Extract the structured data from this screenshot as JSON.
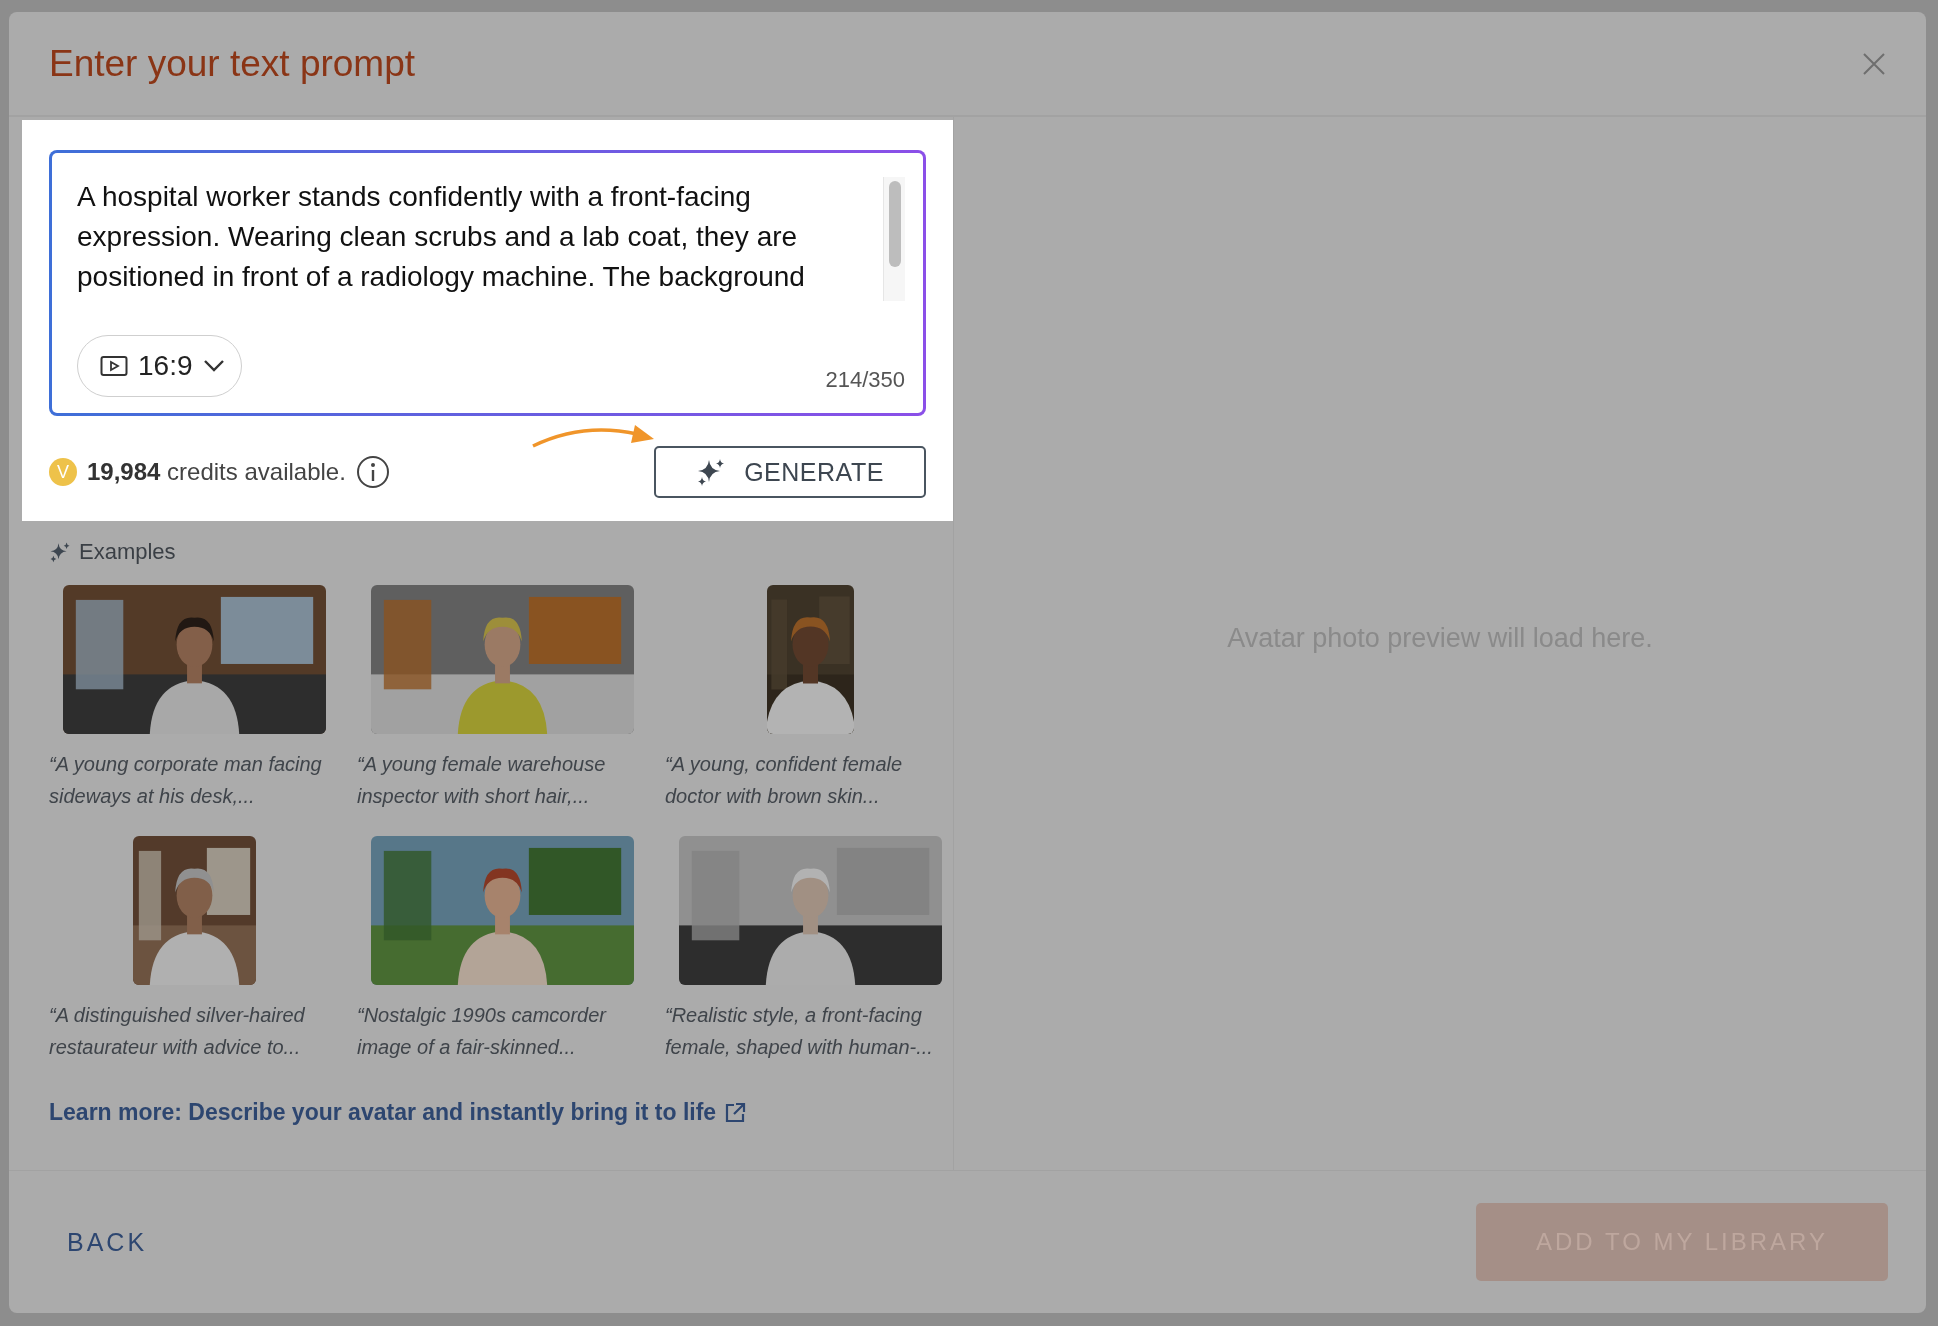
{
  "dialog": {
    "title": "Enter your text prompt"
  },
  "prompt": {
    "value": "A hospital worker stands confidently with a front-facing expression. Wearing clean scrubs and a lab coat, they are positioned in front of a radiology machine. The background",
    "aspect_ratio": "16:9",
    "char_count": "214/350"
  },
  "credits": {
    "coin": "V",
    "amount": "19,984",
    "label": "credits available."
  },
  "generate_button": "GENERATE",
  "examples": {
    "heading": "Examples",
    "items": [
      {
        "caption": "“A young corporate man facing sideways at his desk,..."
      },
      {
        "caption": "“A young female warehouse inspector with short hair,..."
      },
      {
        "caption": "“A young, confident female doctor with brown skin..."
      },
      {
        "caption": "“A distinguished silver-haired restaurateur with advice to..."
      },
      {
        "caption": "“Nostalgic 1990s camcorder image of a fair-skinned..."
      },
      {
        "caption": "“Realistic style, a front-facing female, shaped with human-..."
      }
    ]
  },
  "learn_more": "Learn more: Describe your avatar and instantly bring it to life",
  "preview": {
    "message": "Avatar photo preview will load here."
  },
  "footer": {
    "back_button": "BACK",
    "add_button": {
      "label": "ADD TO MY LIBRARY",
      "disabled": true
    }
  }
}
